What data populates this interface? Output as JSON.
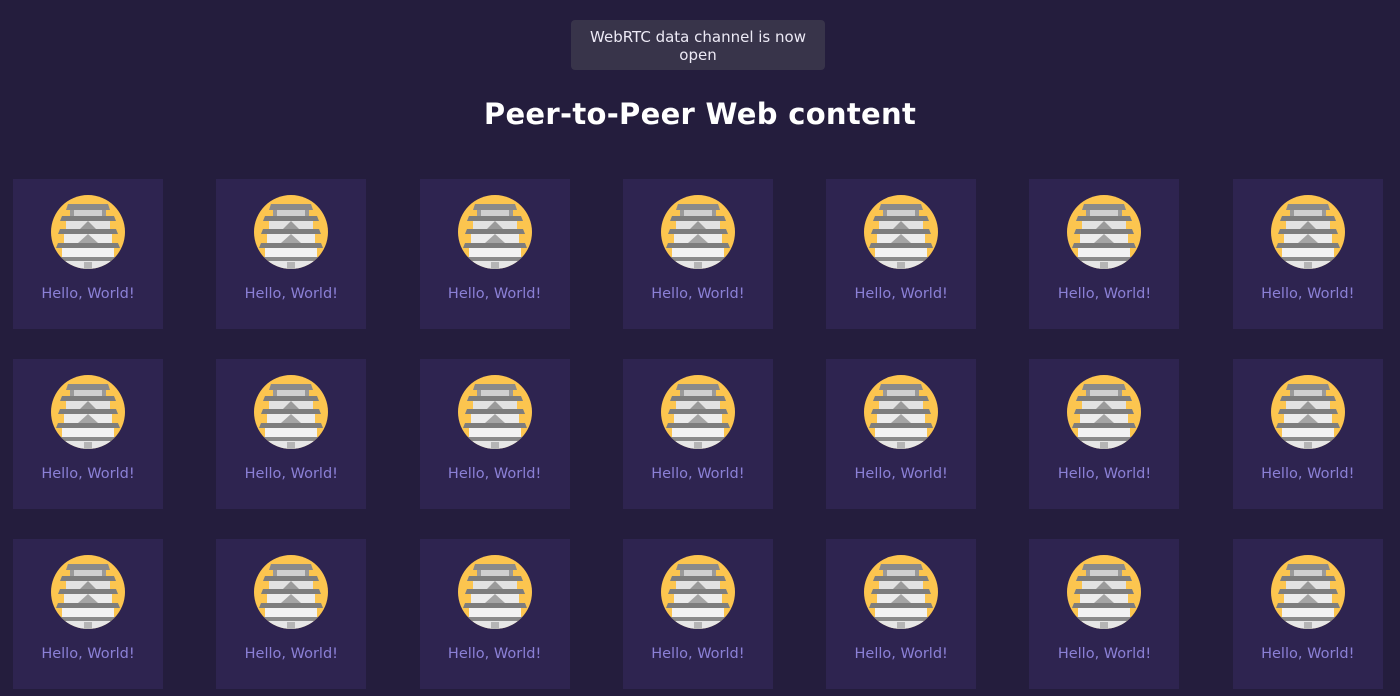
{
  "toast": {
    "message": "WebRTC data channel is now open"
  },
  "page": {
    "title": "Peer-to-Peer Web content"
  },
  "colors": {
    "background": "#241d3d",
    "card": "#2e2450",
    "caption": "#8b80d6",
    "avatar_bg": "#fcc54f"
  },
  "cards": [
    {
      "icon": "house-icon",
      "caption": "Hello, World!"
    },
    {
      "icon": "house-icon",
      "caption": "Hello, World!"
    },
    {
      "icon": "house-icon",
      "caption": "Hello, World!"
    },
    {
      "icon": "house-icon",
      "caption": "Hello, World!"
    },
    {
      "icon": "house-icon",
      "caption": "Hello, World!"
    },
    {
      "icon": "house-icon",
      "caption": "Hello, World!"
    },
    {
      "icon": "house-icon",
      "caption": "Hello, World!"
    },
    {
      "icon": "house-icon",
      "caption": "Hello, World!"
    },
    {
      "icon": "house-icon",
      "caption": "Hello, World!"
    },
    {
      "icon": "house-icon",
      "caption": "Hello, World!"
    },
    {
      "icon": "house-icon",
      "caption": "Hello, World!"
    },
    {
      "icon": "house-icon",
      "caption": "Hello, World!"
    },
    {
      "icon": "house-icon",
      "caption": "Hello, World!"
    },
    {
      "icon": "house-icon",
      "caption": "Hello, World!"
    },
    {
      "icon": "house-icon",
      "caption": "Hello, World!"
    },
    {
      "icon": "house-icon",
      "caption": "Hello, World!"
    },
    {
      "icon": "house-icon",
      "caption": "Hello, World!"
    },
    {
      "icon": "house-icon",
      "caption": "Hello, World!"
    },
    {
      "icon": "house-icon",
      "caption": "Hello, World!"
    },
    {
      "icon": "house-icon",
      "caption": "Hello, World!"
    },
    {
      "icon": "house-icon",
      "caption": "Hello, World!"
    }
  ]
}
